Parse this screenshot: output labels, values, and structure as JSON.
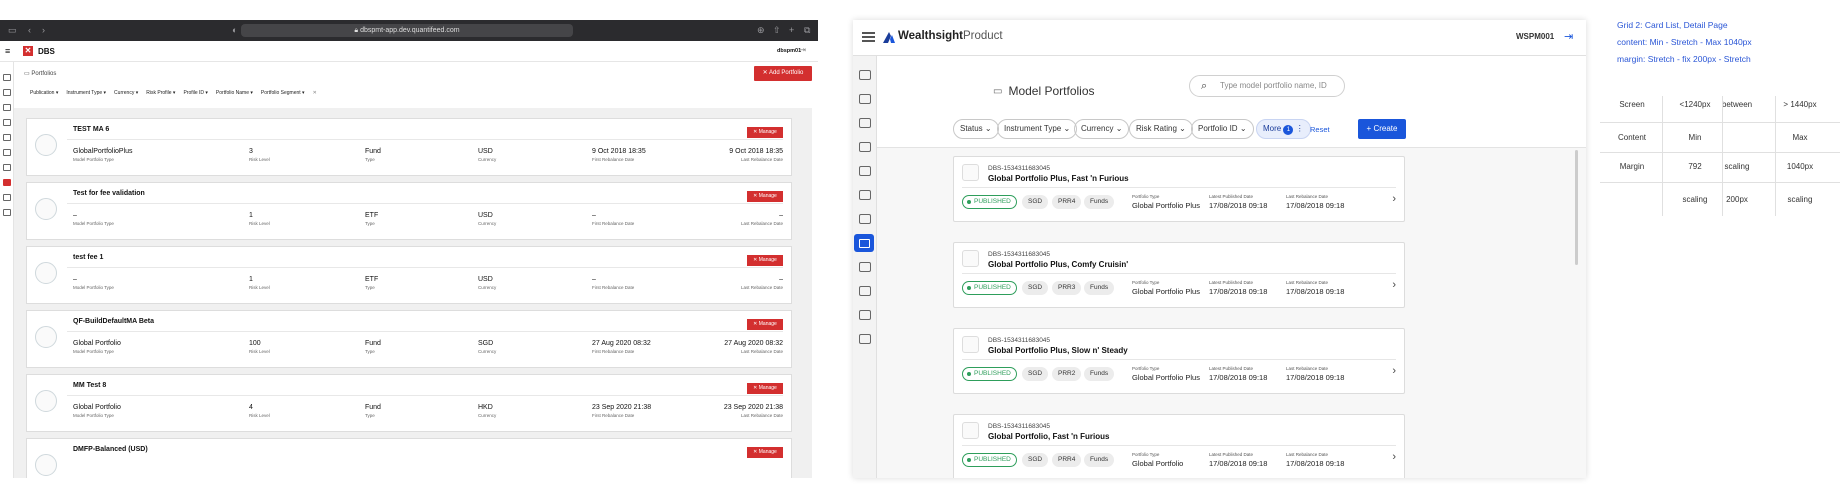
{
  "left_app": {
    "url": "dbspmt-app.dev.quantifeed.com",
    "app_title": "DBS",
    "user": "dbspm01",
    "breadcrumb": "Portfolios",
    "add_button": "Add Portfolio",
    "filters": [
      "Publication",
      "Instrument Type",
      "Currency",
      "Risk Profile",
      "Profile ID",
      "Portfolio Name",
      "Portfolio Segment"
    ],
    "filter_clear": "✕",
    "manage_label": "Manage",
    "field_labels": [
      "Model Portfolio Type",
      "Risk Level",
      "Type",
      "Currency",
      "First Rebalance Date",
      "Last Rebalance Date"
    ],
    "cards": [
      {
        "title": "TEST MA 6",
        "type": "GlobalPortfolioPlus",
        "risk": "3",
        "inst": "Fund",
        "currency": "USD",
        "first": "9 Oct 2018 18:35",
        "last": "9 Oct 2018 18:35"
      },
      {
        "title": "Test for fee validation",
        "type": "–",
        "risk": "1",
        "inst": "ETF",
        "currency": "USD",
        "first": "–",
        "last": "–"
      },
      {
        "title": "test fee 1",
        "type": "–",
        "risk": "1",
        "inst": "ETF",
        "currency": "USD",
        "first": "–",
        "last": "–"
      },
      {
        "title": "QF-BuildDefaultMA Beta",
        "type": "Global Portfolio",
        "risk": "100",
        "inst": "Fund",
        "currency": "SGD",
        "first": "27 Aug 2020 08:32",
        "last": "27 Aug 2020 08:32"
      },
      {
        "title": "MM Test 8",
        "type": "Global Portfolio",
        "risk": "4",
        "inst": "Fund",
        "currency": "HKD",
        "first": "23 Sep 2020 21:38",
        "last": "23 Sep 2020 21:38"
      },
      {
        "title": "DMFP-Balanced (USD)",
        "type": "",
        "risk": "",
        "inst": "",
        "currency": "",
        "first": "",
        "last": ""
      }
    ]
  },
  "right_app": {
    "brand": "Wealthsight",
    "product": "Product",
    "user": "WSPM001",
    "page_title": "Model Portfolios",
    "search_placeholder": "Type model portfolio name, ID",
    "filters": [
      {
        "label": "Status"
      },
      {
        "label": "Instrument Type"
      },
      {
        "label": "Currency"
      },
      {
        "label": "Risk Rating"
      },
      {
        "label": "Portfolio ID"
      }
    ],
    "more_label": "More",
    "more_count": "1",
    "reset_label": "Reset",
    "create_label": "Create",
    "field_labels": {
      "portfolio_type": "Portfolio Type",
      "latest_published": "Latest Published Date",
      "last_rebalance": "Last Rebalance Date"
    },
    "cards": [
      {
        "id": "DBS-1534311683045",
        "name": "Global Portfolio Plus, Fast 'n Furious",
        "status": "PUBLISHED",
        "currency": "SGD",
        "risk": "PRR4",
        "inst": "Funds",
        "portfolio_type": "Global Portfolio Plus",
        "latest_published": "17/08/2018 09:18",
        "last_rebalance": "17/08/2018 09:18"
      },
      {
        "id": "DBS-1534311683045",
        "name": "Global Portfolio Plus, Comfy Cruisin'",
        "status": "PUBLISHED",
        "currency": "SGD",
        "risk": "PRR3",
        "inst": "Funds",
        "portfolio_type": "Global Portfolio Plus",
        "latest_published": "17/08/2018 09:18",
        "last_rebalance": "17/08/2018 09:18"
      },
      {
        "id": "DBS-1534311683045",
        "name": "Global Portfolio Plus, Slow n' Steady",
        "status": "PUBLISHED",
        "currency": "SGD",
        "risk": "PRR2",
        "inst": "Funds",
        "portfolio_type": "Global Portfolio Plus",
        "latest_published": "17/08/2018 09:18",
        "last_rebalance": "17/08/2018 09:18"
      },
      {
        "id": "DBS-1534311683045",
        "name": "Global Portfolio, Fast 'n Furious",
        "status": "PUBLISHED",
        "currency": "SGD",
        "risk": "PRR4",
        "inst": "Funds",
        "portfolio_type": "Global Portfolio",
        "latest_published": "17/08/2018 09:18",
        "last_rebalance": "17/08/2018 09:18"
      }
    ]
  },
  "notes": {
    "line1": "Grid 2: Card List, Detail Page",
    "line2": "content: Min - Stretch - Max 1040px",
    "line3": "margin: Stretch - fix 200px - Stretch",
    "table": [
      [
        "Screen",
        "<1240px",
        "between",
        "> 1440px"
      ],
      [
        "Content",
        "Min",
        "",
        "Max"
      ],
      [
        "Margin",
        "792",
        "scaling",
        "1040px"
      ],
      [
        "",
        "scaling",
        "200px",
        "scaling"
      ]
    ]
  }
}
